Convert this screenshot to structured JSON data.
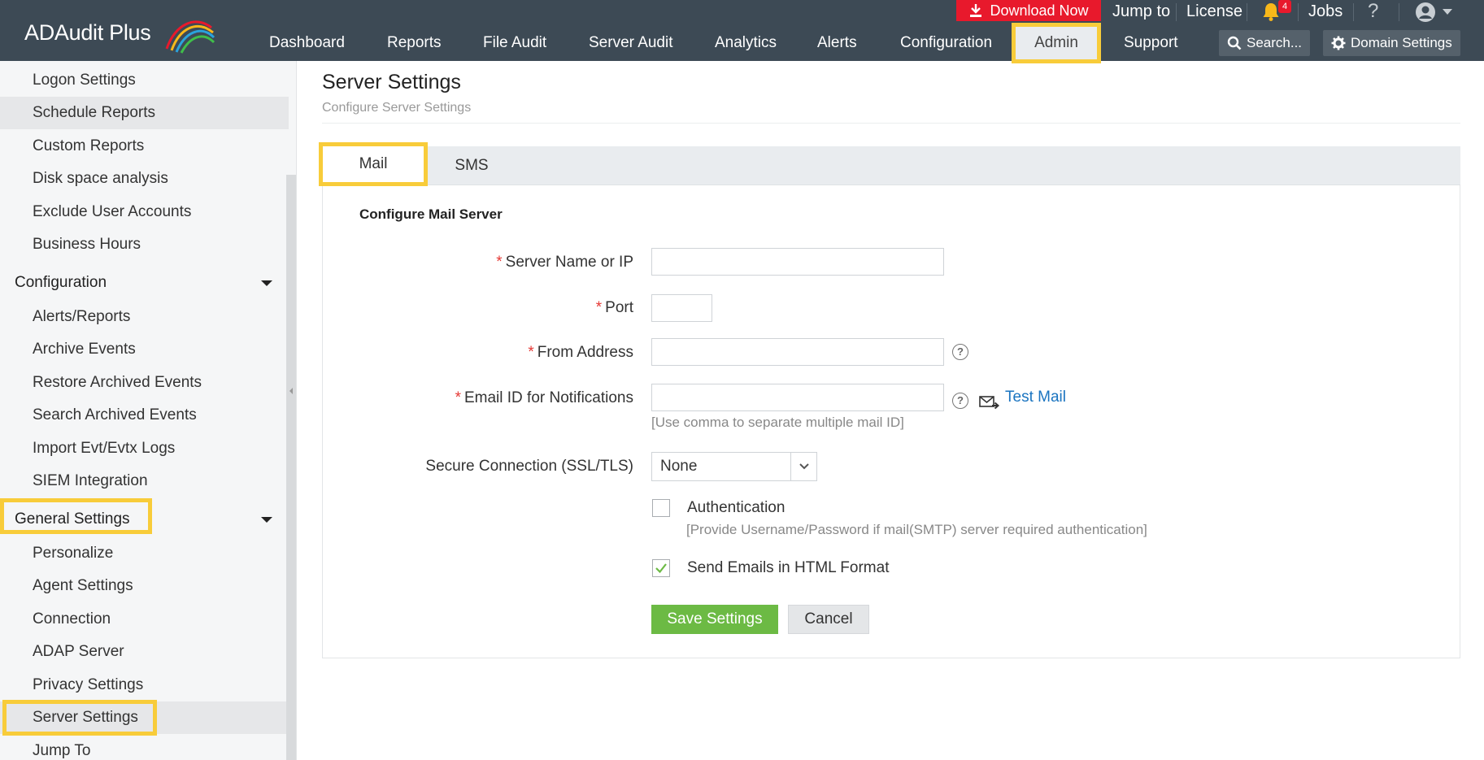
{
  "app": {
    "name": "ADAudit Plus"
  },
  "utility_bar": {
    "download_label": "Download Now",
    "jump_to": "Jump to",
    "license": "License",
    "notification_count": "4",
    "jobs": "Jobs",
    "help_glyph": "?"
  },
  "nav": {
    "items": [
      "Dashboard",
      "Reports",
      "File Audit",
      "Server Audit",
      "Analytics",
      "Alerts",
      "Configuration",
      "Admin",
      "Support"
    ],
    "active": "Admin",
    "search_label": "Search...",
    "domain_settings_label": "Domain Settings"
  },
  "sidebar": {
    "items_top": [
      "Logon Settings",
      "Schedule Reports",
      "Custom Reports",
      "Disk space analysis",
      "Exclude User Accounts",
      "Business Hours"
    ],
    "group_configuration": "Configuration",
    "items_configuration": [
      "Alerts/Reports",
      "Archive Events",
      "Restore Archived Events",
      "Search Archived Events",
      "Import Evt/Evtx Logs",
      "SIEM Integration"
    ],
    "group_general": "General Settings",
    "items_general": [
      "Personalize",
      "Agent Settings",
      "Connection",
      "ADAP Server",
      "Privacy Settings",
      "Server Settings",
      "Jump To"
    ],
    "active_item": "Server Settings"
  },
  "page": {
    "title": "Server Settings",
    "subtitle": "Configure Server Settings"
  },
  "tabs": {
    "mail": "Mail",
    "sms": "SMS",
    "active": "Mail"
  },
  "form": {
    "section_title": "Configure Mail Server",
    "required_mark": "*",
    "server_name_label": "Server Name or IP",
    "server_name_value": "",
    "port_label": "Port",
    "port_value": "",
    "from_address_label": "From Address",
    "from_address_value": "",
    "email_notifications_label": "Email ID for Notifications",
    "email_notifications_value": "",
    "email_hint": "[Use comma to separate multiple mail ID]",
    "test_mail_label": "Test Mail",
    "secure_connection_label": "Secure Connection (SSL/TLS)",
    "secure_connection_value": "None",
    "authentication_label": "Authentication",
    "authentication_checked": false,
    "authentication_hint": "[Provide Username/Password if mail(SMTP) server required authentication]",
    "html_format_label": "Send Emails in HTML Format",
    "html_format_checked": true,
    "save_label": "Save Settings",
    "cancel_label": "Cancel"
  },
  "colors": {
    "header_bg": "#3d4a55",
    "highlight": "#f8cc3a",
    "download_red": "#e8192c",
    "save_green": "#6cba44",
    "link_blue": "#1a74c0",
    "required_red": "#e53935"
  },
  "icons": [
    "download-icon",
    "bell-icon",
    "user-avatar-icon",
    "search-icon",
    "gear-icon",
    "help-icon",
    "send-mail-icon",
    "chevron-down-icon",
    "check-icon"
  ]
}
